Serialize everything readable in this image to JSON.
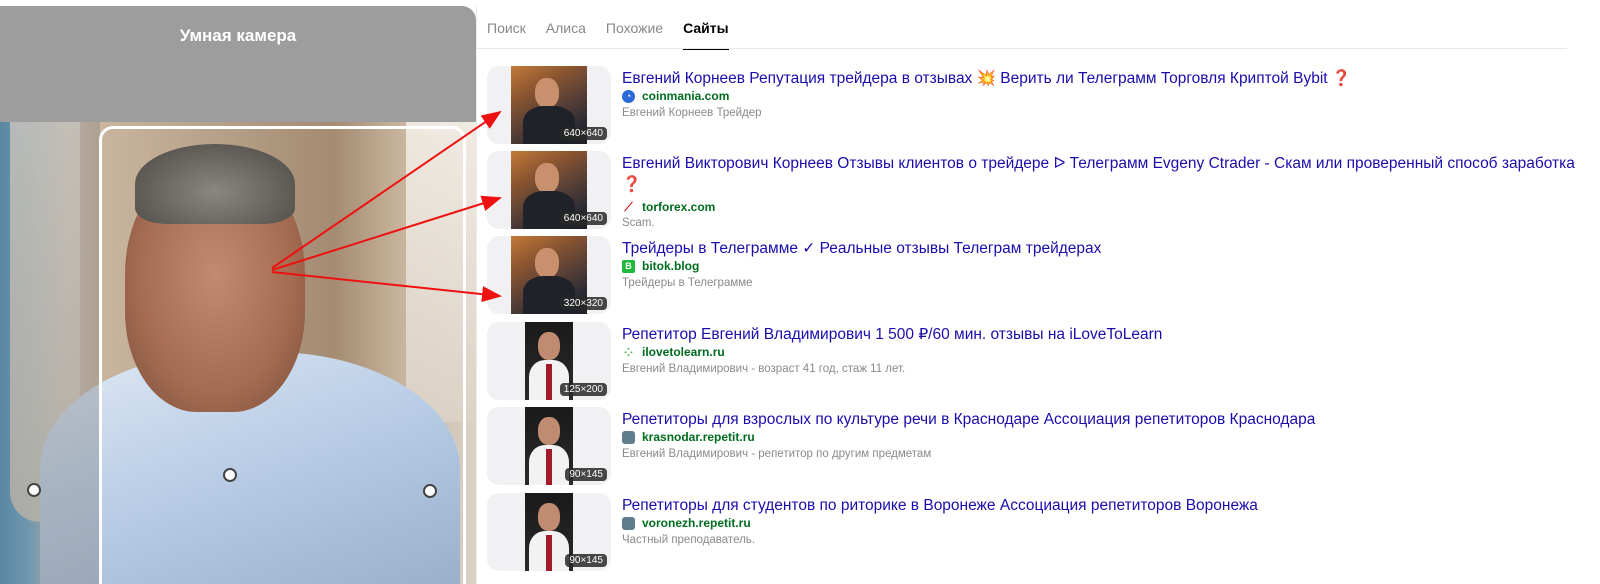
{
  "camera": {
    "title": "Умная камера"
  },
  "tabs": [
    {
      "label": "Поиск",
      "active": false
    },
    {
      "label": "Алиса",
      "active": false
    },
    {
      "label": "Похожие",
      "active": false
    },
    {
      "label": "Сайты",
      "active": true
    }
  ],
  "colors": {
    "link": "#1a0dab",
    "site": "#006c1e",
    "snippet": "#8a8a8a",
    "arrow": "#ee1111"
  },
  "results": [
    {
      "title": "Евгений Корнеев Репутация трейдера в отзывах",
      "title_emoji_1": "💥",
      "title_tail": "Верить ли Телеграмм Торговля Криптой Bybit",
      "title_emoji_2": "❓",
      "site": "coinmania.com",
      "favicon": "globe-icon",
      "snippet": "Евгений Корнеев Трейдер",
      "size": "640×640"
    },
    {
      "title": "Евгений Викторович Корнеев Отзывы клиентов о трейдере ᐅ Телеграмм Evgeny Ctrader - Скам или проверенный способ заработка",
      "title_emoji_2": "❓",
      "site": "torforex.com",
      "favicon": "chart-line-icon",
      "snippet": "Scam.",
      "size": "640×640"
    },
    {
      "title": "Трейдеры в Телеграмме ✓ Реальные отзывы Телеграм трейдерах",
      "site": "bitok.blog",
      "favicon": "bitcoin-icon",
      "snippet": "Трейдеры в Телеграмме",
      "size": "320×320"
    },
    {
      "title": "Репетитор Евгений Владимирович 1 500 ₽/60 мин. отзывы на iLoveToLearn",
      "site": "ilovetolearn.ru",
      "favicon": "dots-icon",
      "snippet": "Евгений Владимирович - возраст 41 год, стаж 11 лет.",
      "size": "125×200"
    },
    {
      "title": "Репетиторы для взрослых по культуре речи в Краснодаре Ассоциация репетиторов Краснодара",
      "site": "krasnodar.repetit.ru",
      "favicon": "photo-icon",
      "snippet": "Евгений Владимирович - репетитор по другим предметам",
      "size": "90×145"
    },
    {
      "title": "Репетиторы для студентов по риторике в Воронеже Ассоциация репетиторов Воронежа",
      "site": "voronezh.repetit.ru",
      "favicon": "photo-icon",
      "snippet": "Частный преподаватель.",
      "size": "90×145"
    }
  ]
}
